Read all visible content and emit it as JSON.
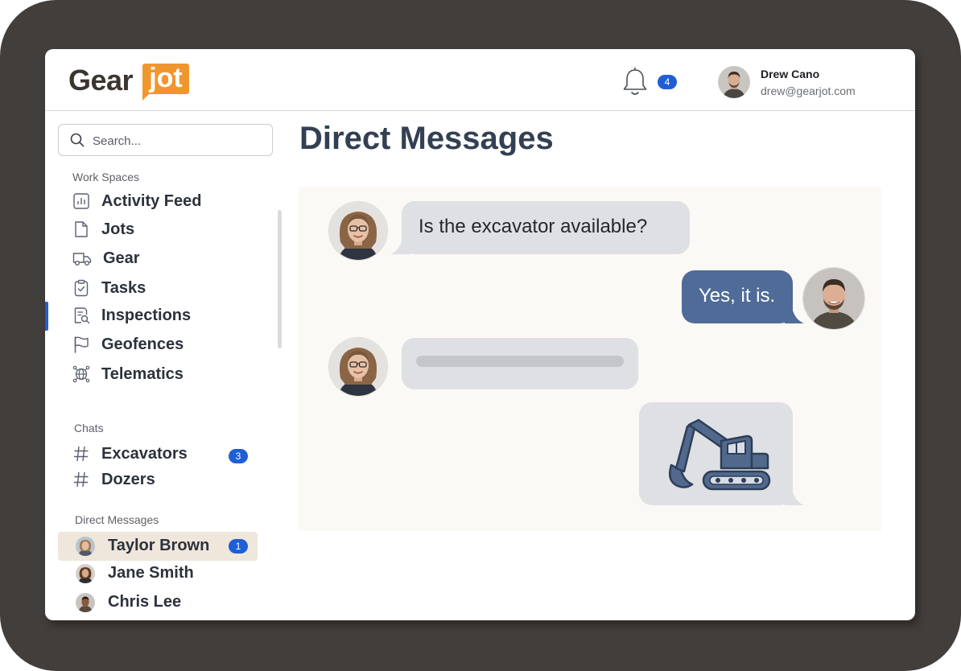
{
  "brand": {
    "logo_part1": "Gear",
    "logo_part2": "jot",
    "accent": "#f0962f"
  },
  "header": {
    "notification_count": "4",
    "user": {
      "name": "Drew Cano",
      "email": "drew@gearjot.com"
    }
  },
  "search": {
    "placeholder": "Search..."
  },
  "sidebar": {
    "workspaces_label": "Work Spaces",
    "workspaces": [
      {
        "label": "Activity Feed",
        "icon": "bar-chart-icon"
      },
      {
        "label": "Jots",
        "icon": "document-icon"
      },
      {
        "label": "Gear",
        "icon": "truck-icon"
      },
      {
        "label": "Tasks",
        "icon": "clipboard-check-icon"
      },
      {
        "label": "Inspections",
        "icon": "inspection-search-icon"
      },
      {
        "label": "Geofences",
        "icon": "flag-icon"
      },
      {
        "label": "Telematics",
        "icon": "globe-network-icon"
      }
    ],
    "chats_label": "Chats",
    "chats": [
      {
        "label": "Excavators",
        "badge": "3"
      },
      {
        "label": "Dozers"
      }
    ],
    "dms_label": "Direct Messages",
    "dms": [
      {
        "label": "Taylor Brown",
        "badge": "1"
      },
      {
        "label": "Jane Smith"
      },
      {
        "label": "Chris Lee"
      }
    ]
  },
  "main": {
    "title": "Direct Messages",
    "messages": [
      {
        "from": "contact",
        "text": "Is the excavator available?"
      },
      {
        "from": "me",
        "text": "Yes, it is."
      },
      {
        "from": "contact",
        "text": ""
      },
      {
        "from": "me",
        "attachment": "excavator-icon"
      }
    ]
  },
  "colors": {
    "primary": "#1f5fd6",
    "bubble_out": "#4f6c98",
    "bubble_in": "#dfe0e3"
  }
}
